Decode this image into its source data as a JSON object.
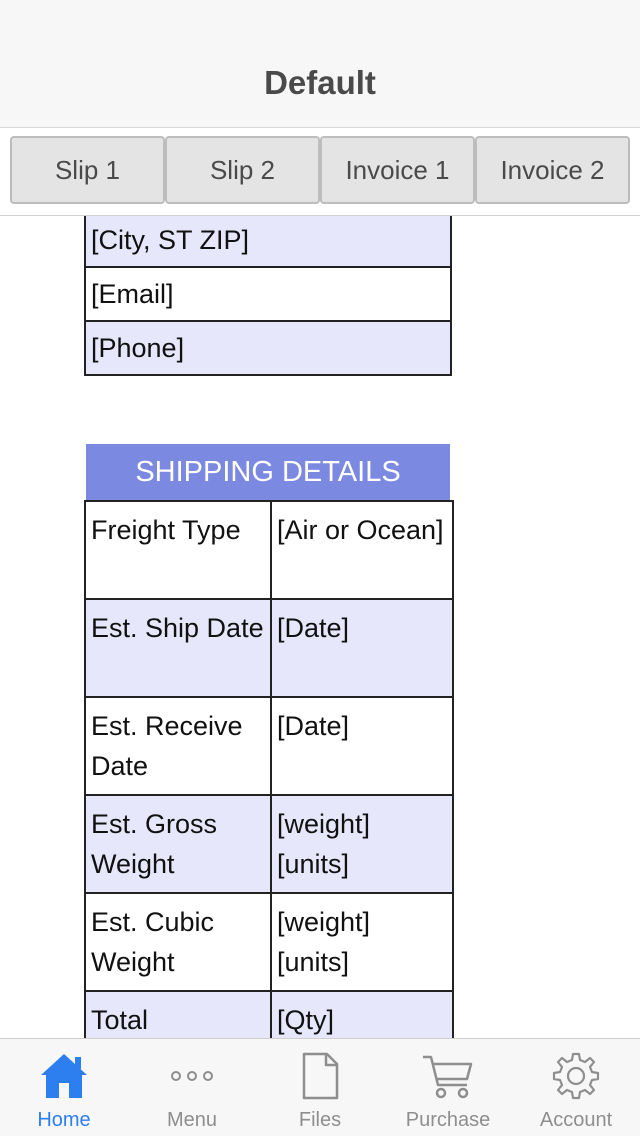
{
  "header": {
    "title": "Default"
  },
  "tabs": [
    {
      "label": "Slip 1"
    },
    {
      "label": "Slip 2"
    },
    {
      "label": "Invoice 1"
    },
    {
      "label": "Invoice 2"
    }
  ],
  "address_rows": [
    {
      "value": "[City, ST  ZIP]"
    },
    {
      "value": "[Email]"
    },
    {
      "value": "[Phone]"
    }
  ],
  "shipping": {
    "title": "SHIPPING DETAILS",
    "rows": [
      {
        "label": "Freight Type",
        "value": "[Air or Ocean]"
      },
      {
        "label": "Est. Ship Date",
        "value": "[Date]"
      },
      {
        "label": "Est. Receive Date",
        "value": "[Date]"
      },
      {
        "label": "Est. Gross Weight",
        "value": "[weight] [units]"
      },
      {
        "label": "Est. Cubic Weight",
        "value": "[weight] [units]"
      },
      {
        "label": "Total",
        "value": "[Qty]"
      }
    ]
  },
  "tabbar": {
    "items": [
      {
        "label": "Home",
        "icon": "home-icon",
        "active": true
      },
      {
        "label": "Menu",
        "icon": "more-dots-icon",
        "active": false
      },
      {
        "label": "Files",
        "icon": "file-icon",
        "active": false
      },
      {
        "label": "Purchase",
        "icon": "cart-icon",
        "active": false
      },
      {
        "label": "Account",
        "icon": "gear-icon",
        "active": false
      }
    ]
  },
  "colors": {
    "accent": "#2d7ff0",
    "header_band": "#7b89e0",
    "row_tint": "#e6e7fa",
    "inactive": "#8e8e8e"
  }
}
